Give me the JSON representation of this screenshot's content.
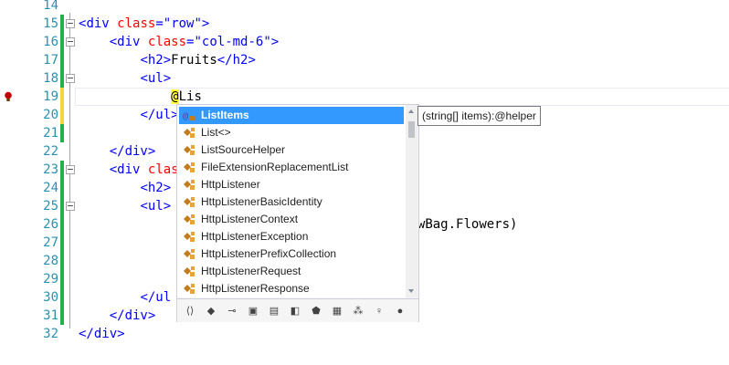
{
  "editor": {
    "lines": [
      {
        "num": "14",
        "code": []
      },
      {
        "num": "15",
        "code": [
          [
            "t",
            "<"
          ],
          [
            "t",
            "div"
          ],
          [
            "k",
            " "
          ],
          [
            "a",
            "class"
          ],
          [
            "t",
            "="
          ],
          [
            "v",
            "\"row\""
          ],
          [
            "t",
            ">"
          ]
        ]
      },
      {
        "num": "16",
        "code": [
          [
            "k",
            "    "
          ],
          [
            "t",
            "<"
          ],
          [
            "t",
            "div"
          ],
          [
            "k",
            " "
          ],
          [
            "a",
            "class"
          ],
          [
            "t",
            "="
          ],
          [
            "v",
            "\"col-md-6\""
          ],
          [
            "t",
            ">"
          ]
        ]
      },
      {
        "num": "17",
        "code": [
          [
            "k",
            "        "
          ],
          [
            "t",
            "<"
          ],
          [
            "t",
            "h2"
          ],
          [
            "t",
            ">"
          ],
          [
            "k",
            "Fruits"
          ],
          [
            "t",
            "</"
          ],
          [
            "t",
            "h2"
          ],
          [
            "t",
            ">"
          ]
        ]
      },
      {
        "num": "18",
        "code": [
          [
            "k",
            "        "
          ],
          [
            "t",
            "<"
          ],
          [
            "t",
            "ul"
          ],
          [
            "t",
            ">"
          ]
        ]
      },
      {
        "num": "19",
        "code": [
          [
            "k",
            "            "
          ],
          [
            "at",
            "@"
          ],
          [
            "k",
            "Lis"
          ]
        ]
      },
      {
        "num": "20",
        "code": [
          [
            "k",
            "        "
          ],
          [
            "t",
            "</"
          ],
          [
            "t",
            "ul"
          ],
          [
            "t",
            ">"
          ]
        ]
      },
      {
        "num": "21",
        "code": []
      },
      {
        "num": "22",
        "code": [
          [
            "k",
            "    "
          ],
          [
            "t",
            "</"
          ],
          [
            "t",
            "div"
          ],
          [
            "t",
            ">"
          ]
        ]
      },
      {
        "num": "23",
        "code": [
          [
            "k",
            "    "
          ],
          [
            "t",
            "<"
          ],
          [
            "t",
            "div"
          ],
          [
            "k",
            " "
          ],
          [
            "a",
            "clas"
          ]
        ]
      },
      {
        "num": "24",
        "code": [
          [
            "k",
            "        "
          ],
          [
            "t",
            "<"
          ],
          [
            "t",
            "h2"
          ],
          [
            "t",
            ">"
          ]
        ]
      },
      {
        "num": "25",
        "code": [
          [
            "k",
            "        "
          ],
          [
            "t",
            "<"
          ],
          [
            "t",
            "ul"
          ],
          [
            "t",
            ">"
          ]
        ]
      },
      {
        "num": "26",
        "code": [
          [
            "k",
            "            "
          ],
          [
            "at",
            ""
          ],
          [
            "k",
            "                          []"
          ],
          [
            "k",
            ")ViewBag.Flowers)"
          ]
        ]
      },
      {
        "num": "27",
        "code": []
      },
      {
        "num": "28",
        "code": []
      },
      {
        "num": "29",
        "code": []
      },
      {
        "num": "30",
        "code": [
          [
            "k",
            "        "
          ],
          [
            "t",
            "</"
          ],
          [
            "t",
            "ul"
          ]
        ]
      },
      {
        "num": "31",
        "code": [
          [
            "k",
            "    "
          ],
          [
            "t",
            "</"
          ],
          [
            "t",
            "div"
          ],
          [
            "t",
            ">"
          ]
        ]
      },
      {
        "num": "32",
        "code": [
          [
            "t",
            "</"
          ],
          [
            "t",
            "div"
          ],
          [
            "t",
            ">"
          ]
        ]
      }
    ]
  },
  "completion": {
    "items": [
      {
        "label": "ListItems",
        "icon": "razor-helper-icon",
        "selected": true
      },
      {
        "label": "List<>",
        "icon": "class-icon"
      },
      {
        "label": "ListSourceHelper",
        "icon": "class-icon"
      },
      {
        "label": "FileExtensionReplacementList",
        "icon": "class-icon"
      },
      {
        "label": "HttpListener",
        "icon": "class-icon"
      },
      {
        "label": "HttpListenerBasicIdentity",
        "icon": "class-icon"
      },
      {
        "label": "HttpListenerContext",
        "icon": "class-icon"
      },
      {
        "label": "HttpListenerException",
        "icon": "class-icon"
      },
      {
        "label": "HttpListenerPrefixCollection",
        "icon": "class-icon"
      },
      {
        "label": "HttpListenerRequest",
        "icon": "class-icon"
      },
      {
        "label": "HttpListenerResponse",
        "icon": "class-icon"
      }
    ],
    "filters": [
      "namespace-icon",
      "class-icon",
      "key-value-icon",
      "structure-icon",
      "enum-icon",
      "delegate-icon",
      "module-icon",
      "module2-icon",
      "interface-icon",
      "lock-icon",
      "extension-icon"
    ],
    "tooltip": "(string[] items):@helper"
  },
  "colors": {
    "selection": "#3399ff",
    "changed_saved": "#22b14c",
    "changed_unsaved": "#f5d43c",
    "line_number": "#2b91af",
    "tag": "#0000ff",
    "attribute": "#ff0000"
  }
}
